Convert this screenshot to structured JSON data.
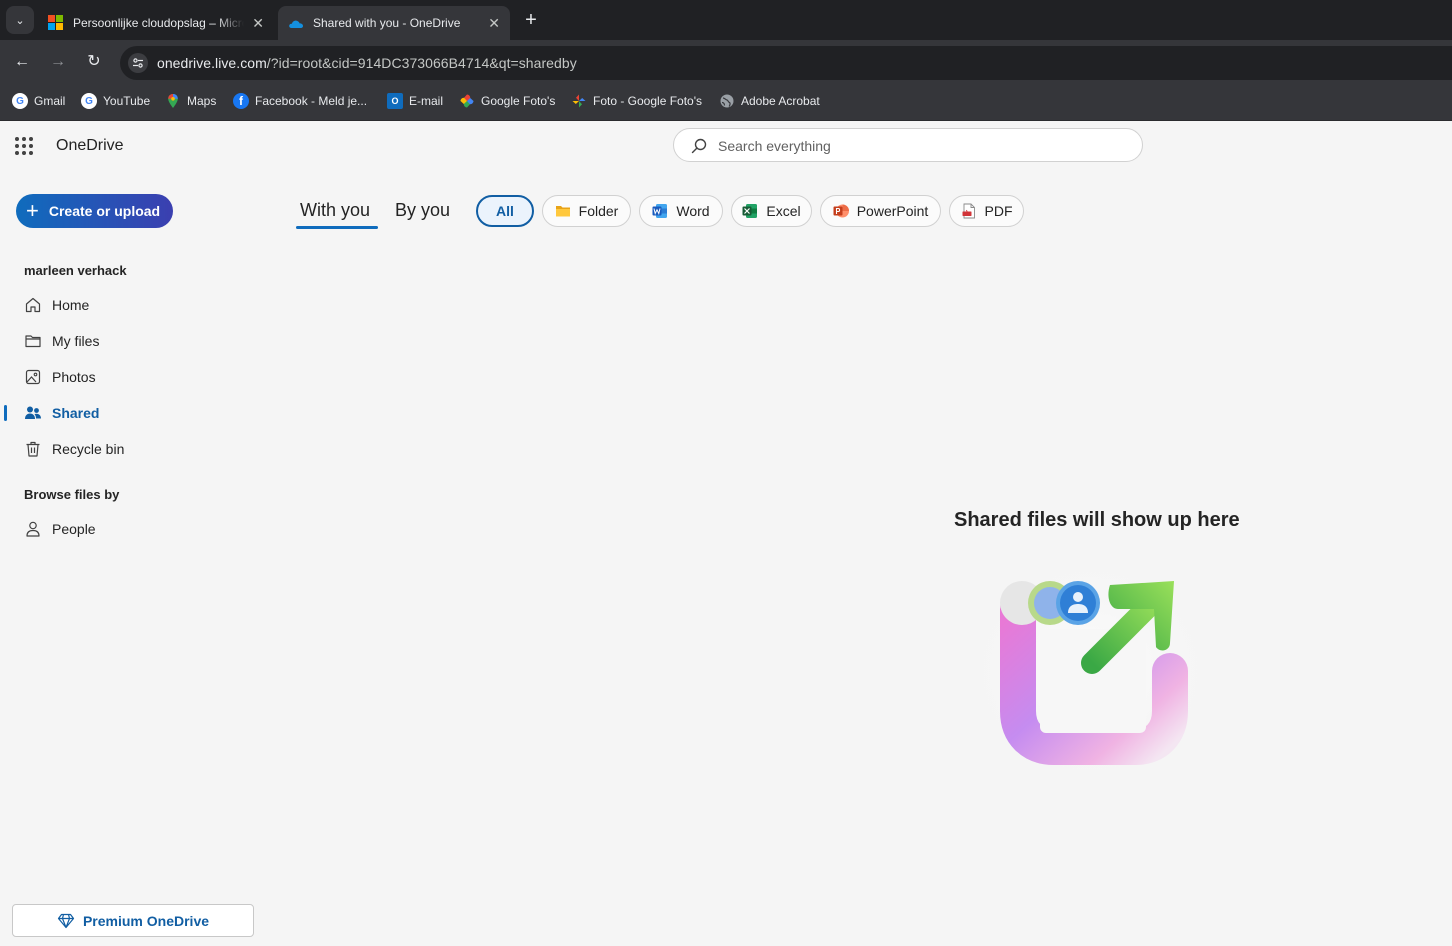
{
  "browser": {
    "tabs": [
      {
        "title": "Persoonlijke cloudopslag – Microsoft OneDrive",
        "active": false
      },
      {
        "title": "Shared with you - OneDrive",
        "active": true
      }
    ],
    "url": {
      "host": "onedrive.live.com",
      "path": "/?id=root&cid=914DC373066B4714&qt=sharedby"
    },
    "bookmarks": [
      {
        "label": "Gmail",
        "icon": "google-icon"
      },
      {
        "label": "YouTube",
        "icon": "google-icon"
      },
      {
        "label": "Maps",
        "icon": "maps-pin-icon"
      },
      {
        "label": "Facebook - Meld je...",
        "icon": "facebook-icon"
      },
      {
        "label": "E-mail",
        "icon": "outlook-icon"
      },
      {
        "label": "Google Foto's",
        "icon": "google-photos-icon"
      },
      {
        "label": "Foto - Google Foto's",
        "icon": "google-photos-icon"
      },
      {
        "label": "Adobe Acrobat",
        "icon": "globe-icon"
      }
    ]
  },
  "app": {
    "brand": "OneDrive",
    "search": {
      "placeholder": "Search everything",
      "value": ""
    },
    "create_button": "Create or upload",
    "user_name": "marleen verhack",
    "nav": [
      {
        "label": "Home",
        "icon": "home-icon"
      },
      {
        "label": "My files",
        "icon": "folder-icon"
      },
      {
        "label": "Photos",
        "icon": "image-icon"
      },
      {
        "label": "Shared",
        "icon": "people-icon",
        "active": true
      },
      {
        "label": "Recycle bin",
        "icon": "trash-icon"
      }
    ],
    "browse_heading": "Browse files by",
    "browse": [
      {
        "label": "People",
        "icon": "person-icon"
      }
    ],
    "premium_button": "Premium OneDrive",
    "pivots": [
      {
        "label": "With you",
        "selected": true
      },
      {
        "label": "By you",
        "selected": false
      }
    ],
    "filters": [
      {
        "label": "All",
        "selected": true
      },
      {
        "label": "Folder",
        "icon": "folder-color-icon"
      },
      {
        "label": "Word",
        "icon": "word-icon"
      },
      {
        "label": "Excel",
        "icon": "excel-icon"
      },
      {
        "label": "PowerPoint",
        "icon": "powerpoint-icon"
      },
      {
        "label": "PDF",
        "icon": "pdf-icon"
      }
    ],
    "empty_state": {
      "title": "Shared files will show up here"
    }
  },
  "colors": {
    "accent": "#0f6cbd",
    "accent_dark": "#115ea3",
    "page_background": "#f5f5f5",
    "browser_dark": "#202124",
    "browser_toolbar": "#35363a"
  }
}
